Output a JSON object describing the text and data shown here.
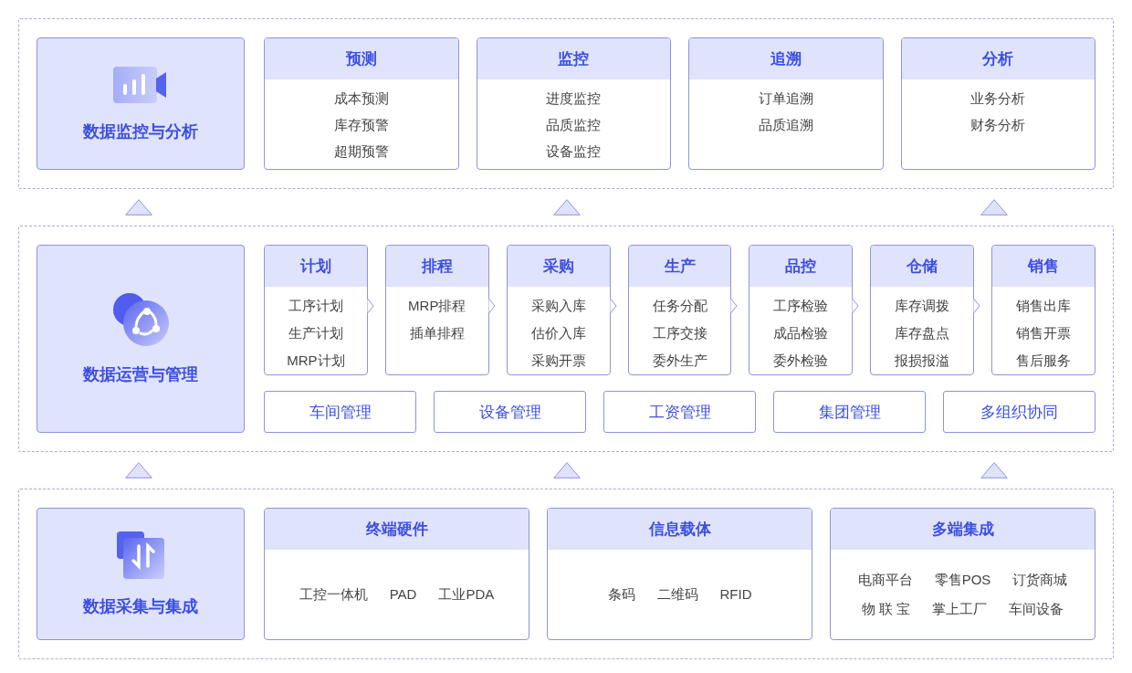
{
  "layers": [
    {
      "kind": "columns",
      "title": "数据监控与分析",
      "groups": [
        {
          "title": "预测",
          "items": [
            "成本预测",
            "库存预警",
            "超期预警"
          ]
        },
        {
          "title": "监控",
          "items": [
            "进度监控",
            "品质监控",
            "设备监控"
          ]
        },
        {
          "title": "追溯",
          "items": [
            "订单追溯",
            "品质追溯"
          ]
        },
        {
          "title": "分析",
          "items": [
            "业务分析",
            "财务分析"
          ]
        }
      ]
    },
    {
      "kind": "flow",
      "title": "数据运营与管理",
      "groups": [
        {
          "title": "计划",
          "items": [
            "工序计划",
            "生产计划",
            "MRP计划"
          ]
        },
        {
          "title": "排程",
          "items": [
            "MRP排程",
            "插单排程"
          ]
        },
        {
          "title": "采购",
          "items": [
            "采购入库",
            "估价入库",
            "采购开票"
          ]
        },
        {
          "title": "生产",
          "items": [
            "任务分配",
            "工序交接",
            "委外生产"
          ]
        },
        {
          "title": "品控",
          "items": [
            "工序检验",
            "成品检验",
            "委外检验"
          ]
        },
        {
          "title": "仓储",
          "items": [
            "库存调拨",
            "库存盘点",
            "报损报溢"
          ]
        },
        {
          "title": "销售",
          "items": [
            "销售出库",
            "销售开票",
            "售后服务"
          ]
        }
      ],
      "modules": [
        "车间管理",
        "设备管理",
        "工资管理",
        "集团管理",
        "多组织协同"
      ]
    },
    {
      "kind": "integration",
      "title": "数据采集与集成",
      "groups": [
        {
          "title": "终端硬件",
          "lines": [
            [
              "工控一体机",
              "PAD",
              "工业PDA"
            ]
          ]
        },
        {
          "title": "信息载体",
          "lines": [
            [
              "条码",
              "二维码",
              "RFID"
            ]
          ]
        },
        {
          "title": "多端集成",
          "lines": [
            [
              "电商平台",
              "零售POS",
              "订货商城"
            ],
            [
              "物 联 宝",
              "掌上工厂",
              "车间设备"
            ]
          ]
        }
      ]
    }
  ]
}
